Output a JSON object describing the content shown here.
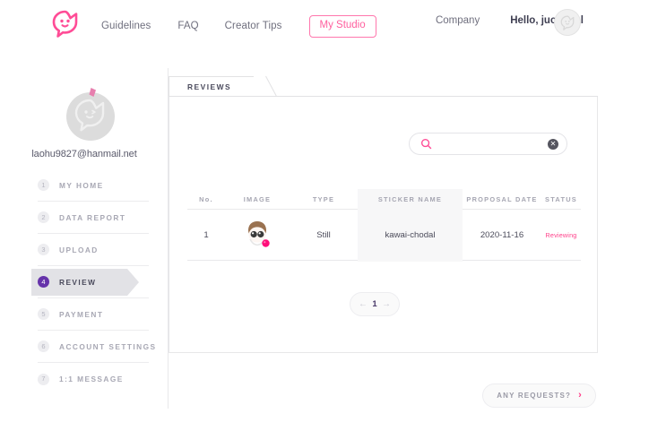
{
  "nav": {
    "logo_icon": "speech-bubble-face-logo",
    "links": [
      {
        "label": "Guidelines"
      },
      {
        "label": "FAQ"
      },
      {
        "label": "Creator Tips"
      }
    ],
    "studio_button": "My Studio",
    "company_link": "Company",
    "greeting_prefix": "Hello, ",
    "username": "juchodal",
    "avatar_icon": "user-avatar-icon"
  },
  "sidebar": {
    "avatar_icon": "profile-sticker-avatar",
    "email": "laohu9827@hanmail.net",
    "items": [
      {
        "num": "1",
        "label": "MY HOME",
        "active": false
      },
      {
        "num": "2",
        "label": "DATA REPORT",
        "active": false
      },
      {
        "num": "3",
        "label": "UPLOAD",
        "active": false
      },
      {
        "num": "4",
        "label": "REVIEW",
        "active": true
      },
      {
        "num": "5",
        "label": "PAYMENT",
        "active": false
      },
      {
        "num": "6",
        "label": "ACCOUNT SETTINGS",
        "active": false
      },
      {
        "num": "7",
        "label": "1:1 MESSAGE",
        "active": false
      }
    ]
  },
  "content": {
    "tab_label": "REVIEWS",
    "search": {
      "value": "",
      "placeholder": "",
      "search_icon": "search-icon",
      "clear_icon": "clear-circle-icon"
    },
    "table": {
      "columns": [
        "No.",
        "IMAGE",
        "TYPE",
        "STICKER NAME",
        "PROPOSAL DATE",
        "STATUS"
      ],
      "rows": [
        {
          "no": "1",
          "image_icon": "sticker-thumbnail",
          "type": "Still",
          "sticker_name": "kawai-chodal",
          "proposal_date": "2020-11-16",
          "status": "Reviewing"
        }
      ]
    },
    "pagination": {
      "prev_icon": "arrow-left-icon",
      "current_page": "1",
      "next_icon": "arrow-right-icon"
    }
  },
  "footer": {
    "request_button": "ANY REQUESTS?",
    "request_chevron_icon": "chevron-right-icon"
  },
  "colors": {
    "brand_pink": "#ff3d88",
    "nav_pink": "#ff5f9e",
    "active_purple": "#6633aa",
    "text_gray": "#6f6f7e",
    "muted": "#a8a8b4"
  }
}
